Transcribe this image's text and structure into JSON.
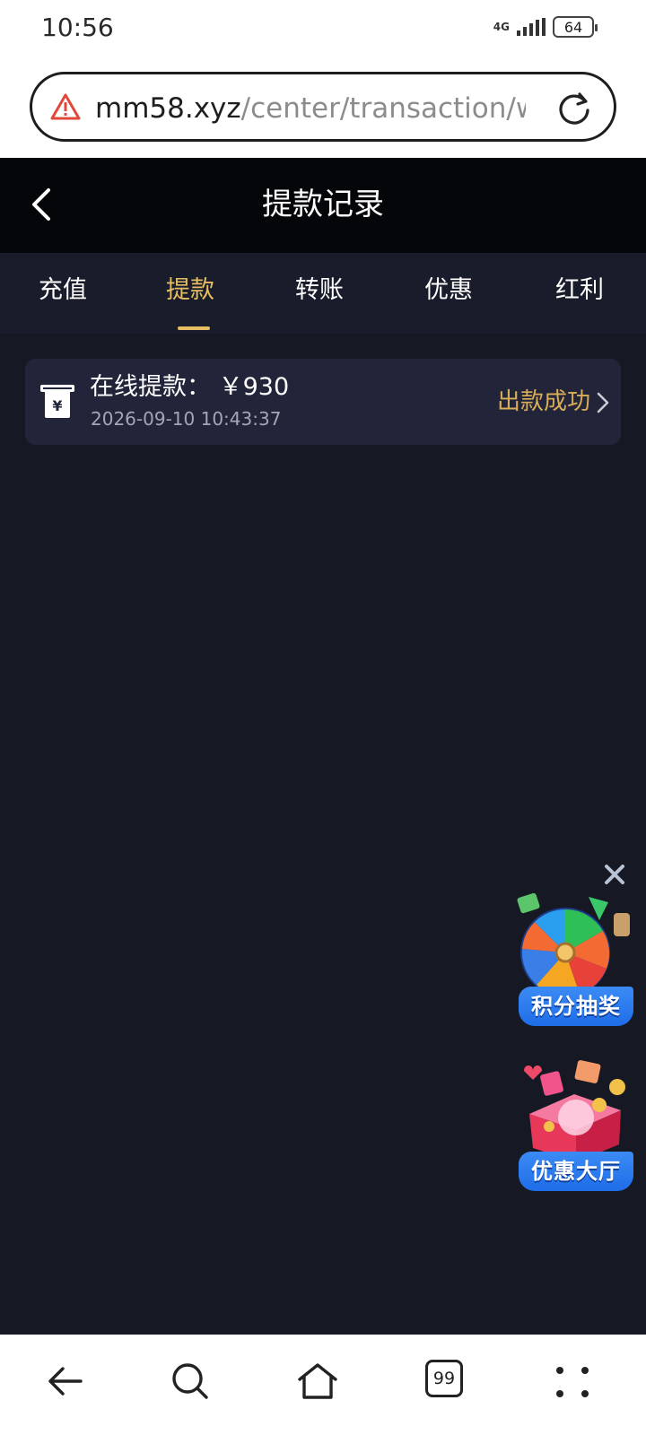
{
  "status_bar": {
    "time": "10:56",
    "network": "4G",
    "battery": "64"
  },
  "browser": {
    "url_domain": "mm58.xyz",
    "url_path": "/center/transaction/wlo",
    "tabs_count": "99"
  },
  "header": {
    "title": "提款记录"
  },
  "tabs": [
    {
      "label": "充值",
      "active": false
    },
    {
      "label": "提款",
      "active": true
    },
    {
      "label": "转账",
      "active": false
    },
    {
      "label": "优惠",
      "active": false
    },
    {
      "label": "红利",
      "active": false
    }
  ],
  "records": [
    {
      "title": "在线提款： ￥930",
      "time": "2026-09-10 10:43:37",
      "status": "出款成功"
    }
  ],
  "floating": {
    "lottery_label": "积分抽奖",
    "promo_label": "优惠大厅"
  },
  "colors": {
    "accent": "#e7bd63",
    "background": "#161924",
    "card": "#22253a"
  }
}
